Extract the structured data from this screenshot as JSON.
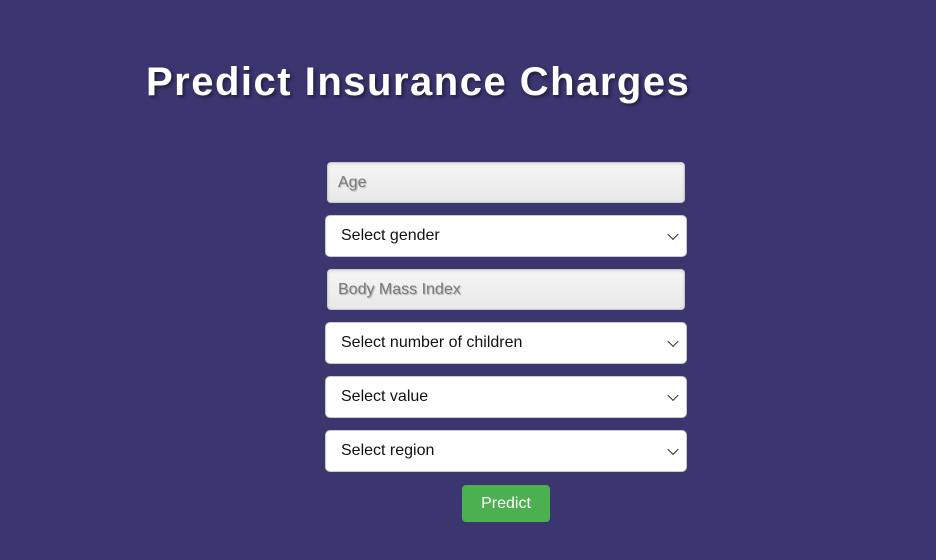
{
  "page": {
    "title": "Predict Insurance Charges"
  },
  "form": {
    "age": {
      "placeholder": "Age",
      "value": ""
    },
    "gender": {
      "selected": "Select gender"
    },
    "bmi": {
      "placeholder": "Body Mass Index",
      "value": ""
    },
    "children": {
      "selected": "Select number of children"
    },
    "smoker": {
      "selected": "Select value"
    },
    "region": {
      "selected": "Select region"
    },
    "predict_label": "Predict"
  },
  "icons": {
    "dropdown": "chevron-down-icon"
  },
  "colors": {
    "background": "#3b3570",
    "button": "#4caf50",
    "title": "#ffffff"
  }
}
